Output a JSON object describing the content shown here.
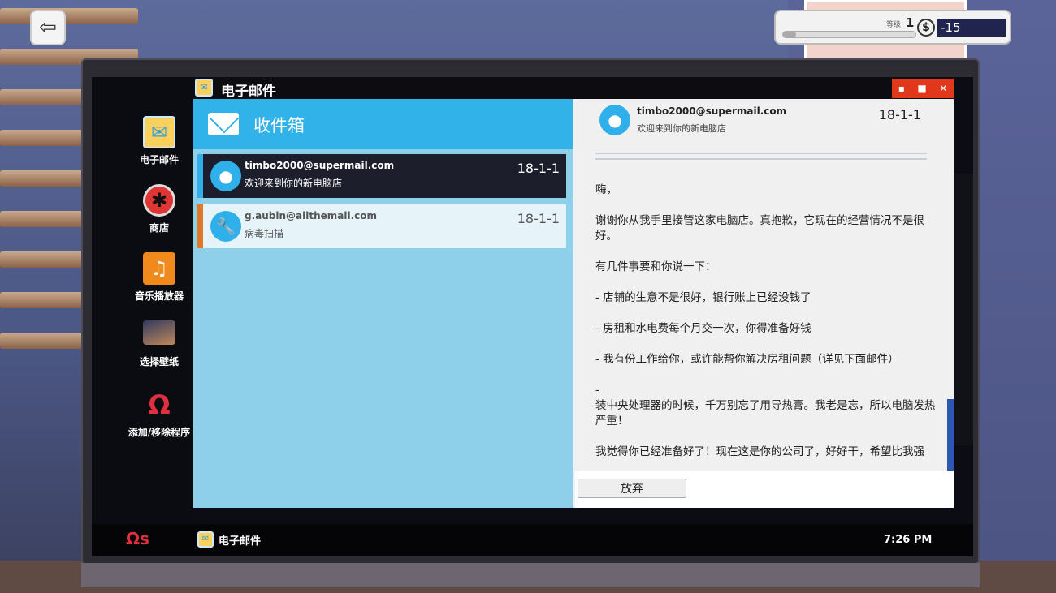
{
  "hud": {
    "level_label": "等级",
    "level": "1",
    "currency_symbol": "$",
    "money": "-15",
    "level_progress": 0.1
  },
  "desktop": {
    "icons": [
      {
        "label": "电子邮件",
        "icon": "mail-icon"
      },
      {
        "label": "商店",
        "icon": "fan-icon"
      },
      {
        "label": "音乐播放器",
        "icon": "music-icon"
      },
      {
        "label": "选择壁纸",
        "icon": "wallpaper-icon"
      },
      {
        "label": "添加/移除程序",
        "icon": "omega-icon"
      }
    ]
  },
  "window": {
    "title": "电子邮件",
    "controls": {
      "minimize": "▪",
      "maximize": "■",
      "close": "✕"
    },
    "inbox_title": "收件箱",
    "mails": [
      {
        "from": "timbo2000@supermail.com",
        "subject": "欢迎来到你的新电脑店",
        "date": "18-1-1",
        "icon": "person-icon",
        "accent": "#2fb0ea"
      },
      {
        "from": "g.aubin@allthemail.com",
        "subject": "病毒扫描",
        "date": "18-1-1",
        "icon": "wrench-icon",
        "accent": "#e0782a"
      }
    ],
    "reader": {
      "from": "timbo2000@supermail.com",
      "subject": "欢迎来到你的新电脑店",
      "date": "18-1-1",
      "paragraphs": [
        "嗨，",
        "谢谢你从我手里接管这家电脑店。真抱歉，它现在的经营情况不是很好。",
        "有几件事要和你说一下：",
        "- 店铺的生意不是很好，银行账上已经没钱了",
        "- 房租和水电费每个月交一次，你得准备好钱",
        "- 我有份工作给你，或许能帮你解决房租问题（详见下面邮件）",
        "-\n装中央处理器的时候，千万别忘了用导热膏。我老是忘，所以电脑发热严重！",
        "我觉得你已经准备好了！现在这是你的公司了，好好干，希望比我强"
      ],
      "discard_label": "放弃"
    }
  },
  "taskbar": {
    "start": "Ωs",
    "app_label": "电子邮件",
    "clock": "7:26 PM"
  }
}
